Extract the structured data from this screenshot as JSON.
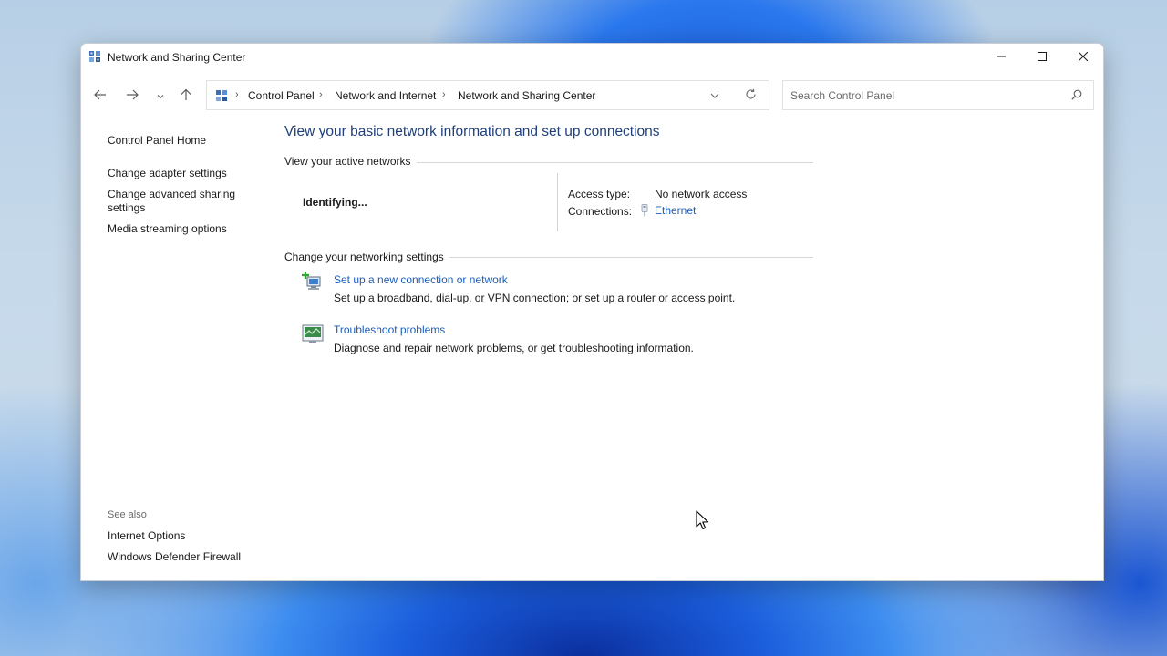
{
  "window": {
    "title": "Network and Sharing Center",
    "controls": {
      "minimize": "minimize",
      "maximize": "maximize",
      "close": "close"
    }
  },
  "navigation": {
    "breadcrumbs": [
      "Control Panel",
      "Network and Internet",
      "Network and Sharing Center"
    ],
    "search_placeholder": "Search Control Panel"
  },
  "sidebar": {
    "items": [
      {
        "label": "Control Panel Home"
      },
      {
        "label": "Change adapter settings"
      },
      {
        "label": "Change advanced sharing settings"
      },
      {
        "label": "Media streaming options"
      }
    ],
    "see_also_heading": "See also",
    "see_also": [
      {
        "label": "Internet Options"
      },
      {
        "label": "Windows Defender Firewall"
      }
    ]
  },
  "main": {
    "heading": "View your basic network information and set up connections",
    "active_networks": {
      "label": "View your active networks",
      "network_name": "Identifying...",
      "access_type_label": "Access type:",
      "access_type_value": "No network access",
      "connections_label": "Connections:",
      "connections_value": "Ethernet"
    },
    "settings": {
      "label": "Change your networking settings",
      "tasks": [
        {
          "icon": "network-setup-icon",
          "title": "Set up a new connection or network",
          "description": "Set up a broadband, dial-up, or VPN connection; or set up a router or access point."
        },
        {
          "icon": "troubleshoot-icon",
          "title": "Troubleshoot problems",
          "description": "Diagnose and repair network problems, or get troubleshooting information."
        }
      ]
    }
  },
  "colors": {
    "link": "#1e5db8",
    "heading": "#1e3f7a",
    "text": "#1a1a1a",
    "muted": "#6b6b6b",
    "window_bg": "#ffffff"
  }
}
